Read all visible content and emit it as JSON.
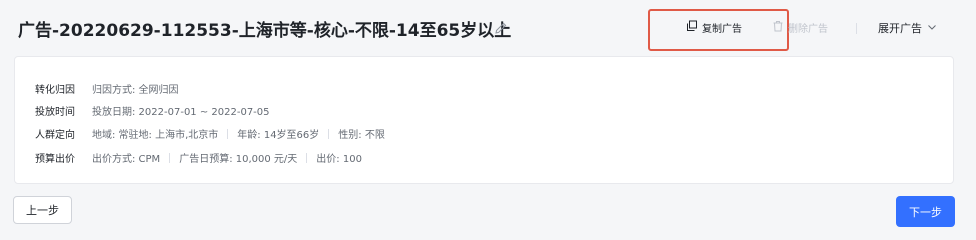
{
  "header": {
    "title": "广告-20220629-112553-上海市等-核心-不限-14至65岁以上",
    "copy_label": "复制广告",
    "delete_label": "删除广告",
    "expand_label": "展开广告"
  },
  "summary": {
    "attribution": {
      "label": "转化归因",
      "items": [
        "归因方式: 全网归因"
      ]
    },
    "schedule": {
      "label": "投放时间",
      "items": [
        "投放日期: 2022-07-01 ~ 2022-07-05"
      ]
    },
    "audience": {
      "label": "人群定向",
      "items": [
        "地域: 常驻地: 上海市,北京市",
        "年龄: 14岁至66岁",
        "性别: 不限"
      ]
    },
    "budget": {
      "label": "预算出价",
      "items": [
        "出价方式: CPM",
        "广告日预算: 10,000 元/天",
        "出价: 100"
      ]
    }
  },
  "footer": {
    "prev_label": "上一步",
    "next_label": "下一步"
  },
  "colors": {
    "primary": "#3370ff",
    "highlight": "#e05a47",
    "disabled": "#c0c4cc"
  }
}
